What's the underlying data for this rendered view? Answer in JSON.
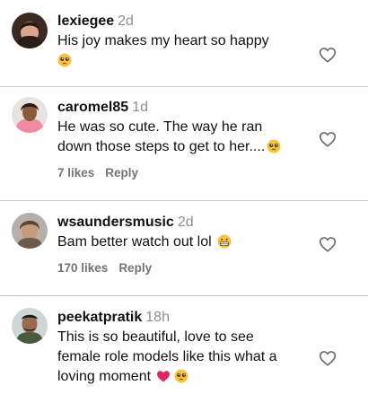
{
  "comments": [
    {
      "username": "lexiegee",
      "time": "2d",
      "lines": [
        "His joy makes my heart so happy"
      ],
      "emojis": [
        "pleading-face"
      ],
      "likes": "",
      "reply_label": ""
    },
    {
      "username": "caromel85",
      "time": "1d",
      "lines": [
        "He was so cute. The way he ran",
        "down those steps to get to her...."
      ],
      "emojis": [
        "pleading-face"
      ],
      "likes": "7 likes",
      "reply_label": "Reply"
    },
    {
      "username": "wsaundersmusic",
      "time": "2d",
      "lines": [
        "Bam better watch out lol"
      ],
      "emojis": [
        "grimacing-face"
      ],
      "likes": "170 likes",
      "reply_label": "Reply"
    },
    {
      "username": "peekatpratik",
      "time": "18h",
      "lines": [
        "This is so beautiful, love to see",
        "female role models like this what a",
        "loving moment"
      ],
      "emojis": [
        "red-heart",
        "pleading-face"
      ],
      "likes": "",
      "reply_label": ""
    }
  ],
  "icons": {
    "like": "heart-outline-icon"
  },
  "colors": {
    "text": "#111111",
    "muted": "#737373",
    "timestamp": "#8e8e8e",
    "divider": "#c9c9c9",
    "heart_emoji": "#e0245e"
  }
}
